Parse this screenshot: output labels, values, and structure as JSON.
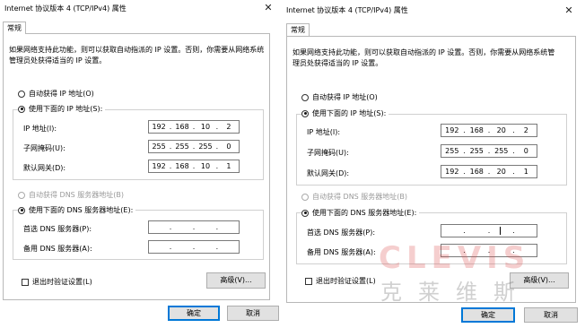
{
  "dialogs": [
    {
      "title": "Internet 协议版本 4 (TCP/IPv4) 属性",
      "close_glyph": "✕",
      "tab": "常规",
      "description": "如果网络支持此功能，则可以获取自动指派的 IP 设置。否则，你需要从网络系统管理员处获得适当的 IP 设置。",
      "auto_ip_label": "自动获得 IP 地址(O)",
      "manual_ip_label": "使用下面的 IP 地址(S):",
      "ip_label": "IP 地址(I):",
      "subnet_label": "子网掩码(U):",
      "gateway_label": "默认网关(D):",
      "ip": [
        "192",
        "168",
        "10",
        "2"
      ],
      "subnet": [
        "255",
        "255",
        "255",
        "0"
      ],
      "gateway": [
        "192",
        "168",
        "10",
        "1"
      ],
      "auto_dns_label": "自动获得 DNS 服务器地址(B)",
      "manual_dns_label": "使用下面的 DNS 服务器地址(E):",
      "preferred_dns_label": "首选 DNS 服务器(P):",
      "alternate_dns_label": "备用 DNS 服务器(A):",
      "preferred_dns": [
        "",
        "",
        "",
        ""
      ],
      "alternate_dns": [
        "",
        "",
        "",
        ""
      ],
      "validate_label": "退出时验证设置(L)",
      "advanced_label": "高级(V)...",
      "ok_label": "确定",
      "cancel_label": "取消"
    },
    {
      "title": "Internet 协议版本 4 (TCP/IPv4) 属性",
      "close_glyph": "✕",
      "tab": "常规",
      "description": "如果网络支持此功能，则可以获取自动指派的 IP 设置。否则，你需要从网络系统管理员处获得适当的 IP 设置。",
      "auto_ip_label": "自动获得 IP 地址(O)",
      "manual_ip_label": "使用下面的 IP 地址(S):",
      "ip_label": "IP 地址(I):",
      "subnet_label": "子网掩码(U):",
      "gateway_label": "默认网关(D):",
      "ip": [
        "192",
        "168",
        "20",
        "2"
      ],
      "subnet": [
        "255",
        "255",
        "255",
        "0"
      ],
      "gateway": [
        "192",
        "168",
        "20",
        "1"
      ],
      "auto_dns_label": "自动获得 DNS 服务器地址(B)",
      "manual_dns_label": "使用下面的 DNS 服务器地址(E):",
      "preferred_dns_label": "首选 DNS 服务器(P):",
      "alternate_dns_label": "备用 DNS 服务器(A):",
      "preferred_dns": [
        "",
        "",
        "",
        ""
      ],
      "alternate_dns": [
        "",
        "",
        "",
        ""
      ],
      "validate_label": "退出时验证设置(L)",
      "advanced_label": "高级(V)...",
      "ok_label": "确定",
      "cancel_label": "取消"
    }
  ],
  "watermark": {
    "word": "CLEVIS",
    "chinese": "克莱维斯"
  },
  "colors": {
    "accent": "#0078d7",
    "button_bg": "#e1e1e1",
    "disabled_text": "#9a9a9a"
  }
}
